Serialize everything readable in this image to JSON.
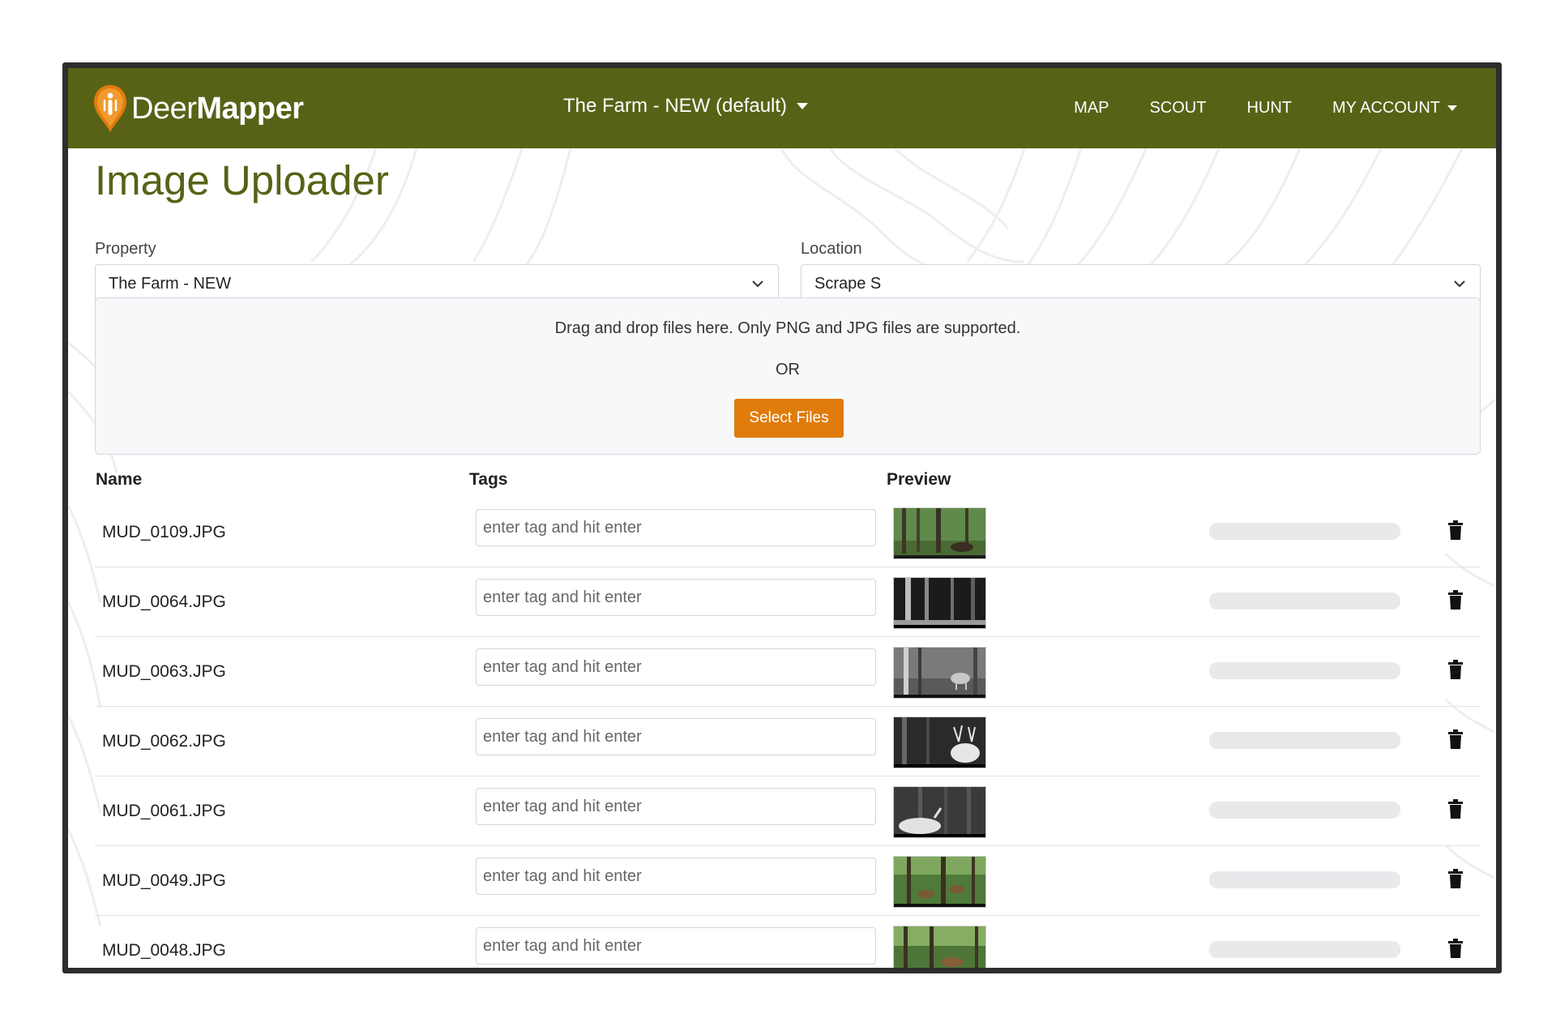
{
  "navbar": {
    "brand_part1": "Deer",
    "brand_part2": "Mapper",
    "property_switcher": "The Farm - NEW (default)",
    "links": [
      "MAP",
      "SCOUT",
      "HUNT",
      "MY ACCOUNT"
    ]
  },
  "page": {
    "title": "Image Uploader",
    "property_label": "Property",
    "property_value": "The Farm - NEW",
    "location_label": "Location",
    "location_value": "Scrape S"
  },
  "dropzone": {
    "instructions": "Drag and drop files here. Only PNG and JPG files are supported.",
    "or_text": "OR",
    "button_label": "Select Files"
  },
  "table": {
    "headers": {
      "name": "Name",
      "tags": "Tags",
      "preview": "Preview"
    },
    "tag_placeholder": "enter tag and hit enter",
    "rows": [
      {
        "name": "MUD_0109.JPG",
        "progress": 0
      },
      {
        "name": "MUD_0064.JPG",
        "progress": 0
      },
      {
        "name": "MUD_0063.JPG",
        "progress": 0
      },
      {
        "name": "MUD_0062.JPG",
        "progress": 0
      },
      {
        "name": "MUD_0061.JPG",
        "progress": 0
      },
      {
        "name": "MUD_0049.JPG",
        "progress": 0
      },
      {
        "name": "MUD_0048.JPG",
        "progress": 0
      }
    ]
  },
  "colors": {
    "navbar": "#586217",
    "accent": "#e07c0c",
    "title": "#586217"
  },
  "icons": [
    "deer-pin-logo-icon",
    "caret-down-icon",
    "chevron-down-icon",
    "trash-icon"
  ]
}
